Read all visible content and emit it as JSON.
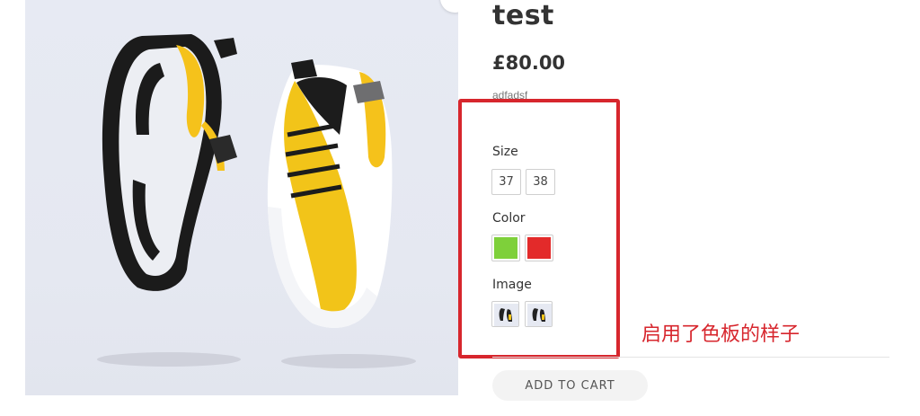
{
  "product": {
    "title": "test",
    "price": "£80.00",
    "description": "adfadsf",
    "image_alt": "sneaker-product-image"
  },
  "attributes": {
    "size": {
      "label": "Size",
      "options": [
        "37",
        "38"
      ]
    },
    "color": {
      "label": "Color",
      "options": [
        {
          "name": "green",
          "hex": "#7ed03a"
        },
        {
          "name": "red",
          "hex": "#e32a2a"
        }
      ]
    },
    "image": {
      "label": "Image",
      "options": [
        "shoe-thumbnail-1",
        "shoe-thumbnail-2"
      ]
    }
  },
  "cart": {
    "add_label": "ADD TO CART"
  },
  "annotation": {
    "text": "启用了色板的样子",
    "color": "#d7262d"
  }
}
